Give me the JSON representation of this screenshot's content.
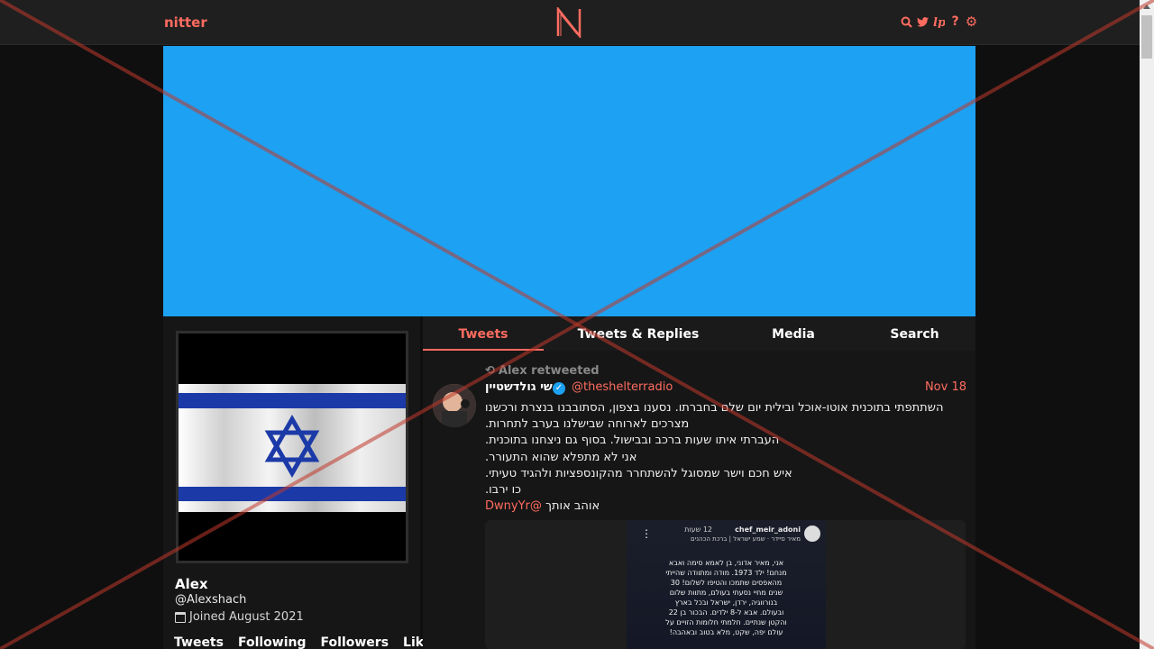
{
  "nav": {
    "brand": "nitter",
    "icons": [
      "search-icon",
      "twitter-bird-icon",
      "rss-icon",
      "help-icon",
      "gear-icon"
    ]
  },
  "banner": {
    "color": "#1da1f2"
  },
  "profile": {
    "name": "Alex",
    "handle": "@Alexshach",
    "joined": "Joined August 2021",
    "stats": {
      "tweets": "Tweets",
      "following": "Following",
      "followers": "Followers",
      "likes": "Likes"
    }
  },
  "tabs": [
    {
      "label": "Tweets",
      "active": true
    },
    {
      "label": "Tweets & Replies",
      "active": false
    },
    {
      "label": "Media",
      "active": false
    },
    {
      "label": "Search",
      "active": false
    }
  ],
  "tweet": {
    "retweet_by": "Alex retweeted",
    "author_name": "שי גולדשטיין",
    "author_handle": "@theshelterradio",
    "date": "Nov 18",
    "lines": [
      "השתתפתי בתוכנית אוטו-אוכל ובילית יום שלם בחברתו. נסענו בצפון, הסתובבנו בנצרת ורכשנו",
      "מצרכים לארוחה שבישלנו בערב לתחרות.",
      "העברתי איתו שעות ברכב ובבישול. בסוף גם ניצחנו בתוכנית.",
      "אני לא מתפלא שהוא התעורר.",
      "איש חכם וישר שמסוגל להשתחרר מהקונספציות ולהגיד טעיתי.",
      "כו ירבו."
    ],
    "last_line_text": "אוהב אותך",
    "mention": "@DwnyYr",
    "media": {
      "story_user": "chef_meir_adoni",
      "story_time": "12 שעות",
      "story_sub": "מאיר סיידר · שמע ישראל | ברכת הכהנים",
      "story_lines": [
        "אני, מאיר אדוני, בן לאמא סימה ואבא",
        "מנחם! ילד 1973. מודה ומתוודה שהייתי",
        "מהאפסים שתמכו והטיפו לשלום! 30",
        "שנים מחיי נסעתי בעולם, מתוות שלום",
        "בנורווגיה, ירדן, ישראל ובכל בארץ",
        "ובעולם. אבא ל-8 ילדים. הבכור בן 22",
        "והקטן שנתיים. חלמתי חלומות הזויים על",
        "עולם יפה, שקט, מלא בטוב ובאהבה!"
      ]
    }
  }
}
